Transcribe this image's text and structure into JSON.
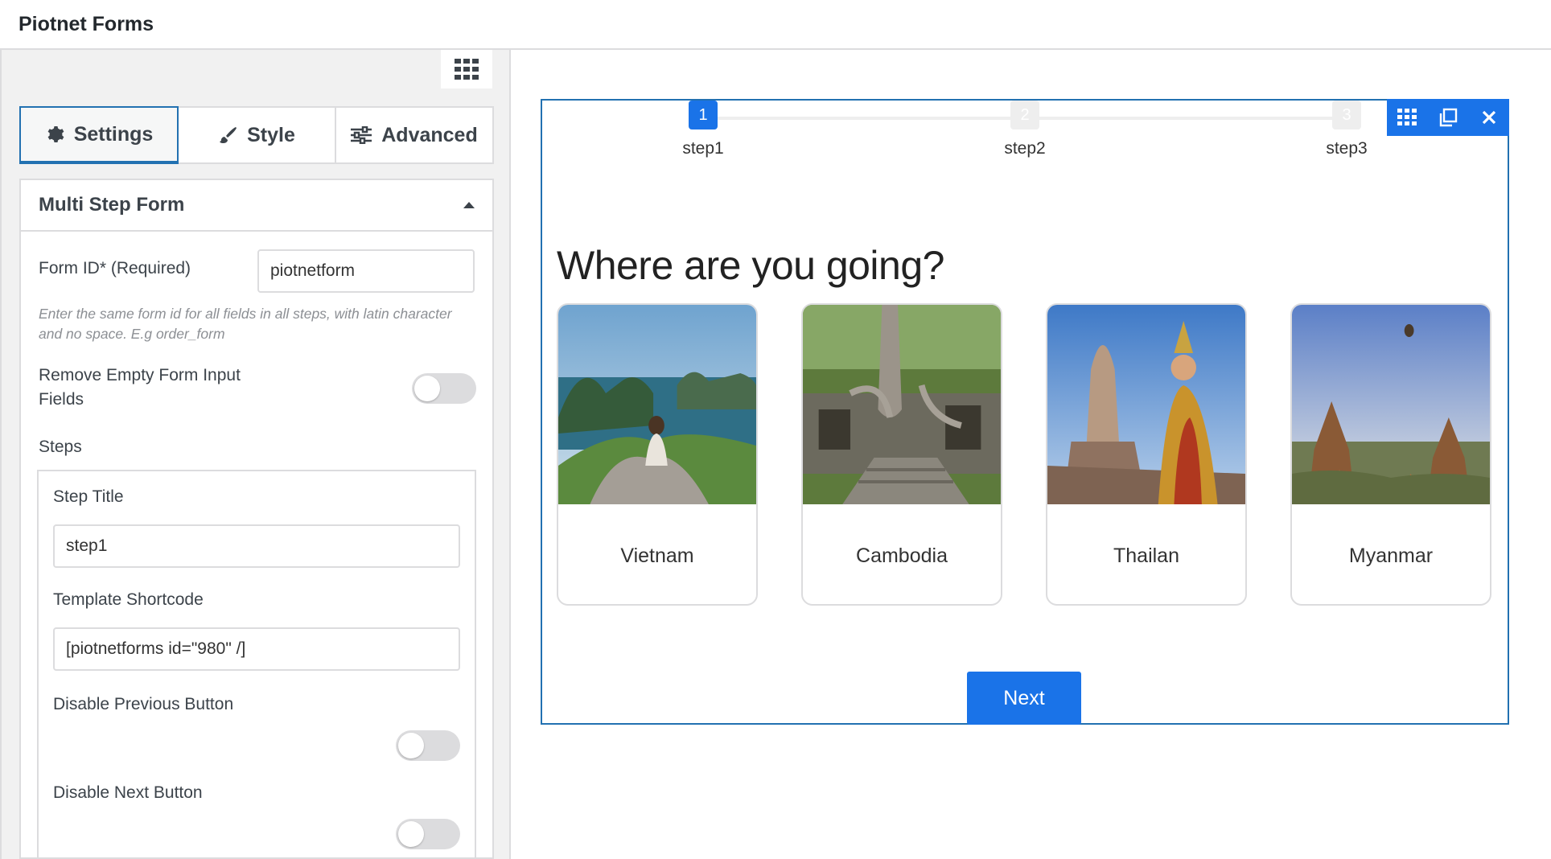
{
  "app": {
    "title": "Piotnet Forms"
  },
  "tabs": [
    {
      "label": "Settings",
      "icon": "gear-icon"
    },
    {
      "label": "Style",
      "icon": "brush-icon"
    },
    {
      "label": "Advanced",
      "icon": "sliders-icon"
    }
  ],
  "section": {
    "title": "Multi Step Form",
    "form_id_label": "Form ID* (Required)",
    "form_id_value": "piotnetform",
    "form_id_help": "Enter the same form id for all fields in all steps, with latin character and no space. E.g order_form",
    "remove_empty_label": "Remove Empty Form Input Fields",
    "steps_label": "Steps",
    "step": {
      "title_label": "Step Title",
      "title_value": "step1",
      "shortcode_label": "Template Shortcode",
      "shortcode_value": "[piotnetforms id=\"980\" /]",
      "disable_prev_label": "Disable Previous Button",
      "disable_next_label": "Disable Next Button"
    }
  },
  "preview": {
    "steps": [
      {
        "num": "1",
        "label": "step1",
        "active": true
      },
      {
        "num": "2",
        "label": "step2",
        "active": false
      },
      {
        "num": "3",
        "label": "step3",
        "active": false
      }
    ],
    "question": "Where are you going?",
    "options": [
      {
        "label": "Vietnam"
      },
      {
        "label": "Cambodia"
      },
      {
        "label": "Thailan"
      },
      {
        "label": "Myanmar"
      }
    ],
    "next_label": "Next"
  },
  "colors": {
    "accent": "#1a73e8",
    "border_accent": "#2271b1"
  }
}
